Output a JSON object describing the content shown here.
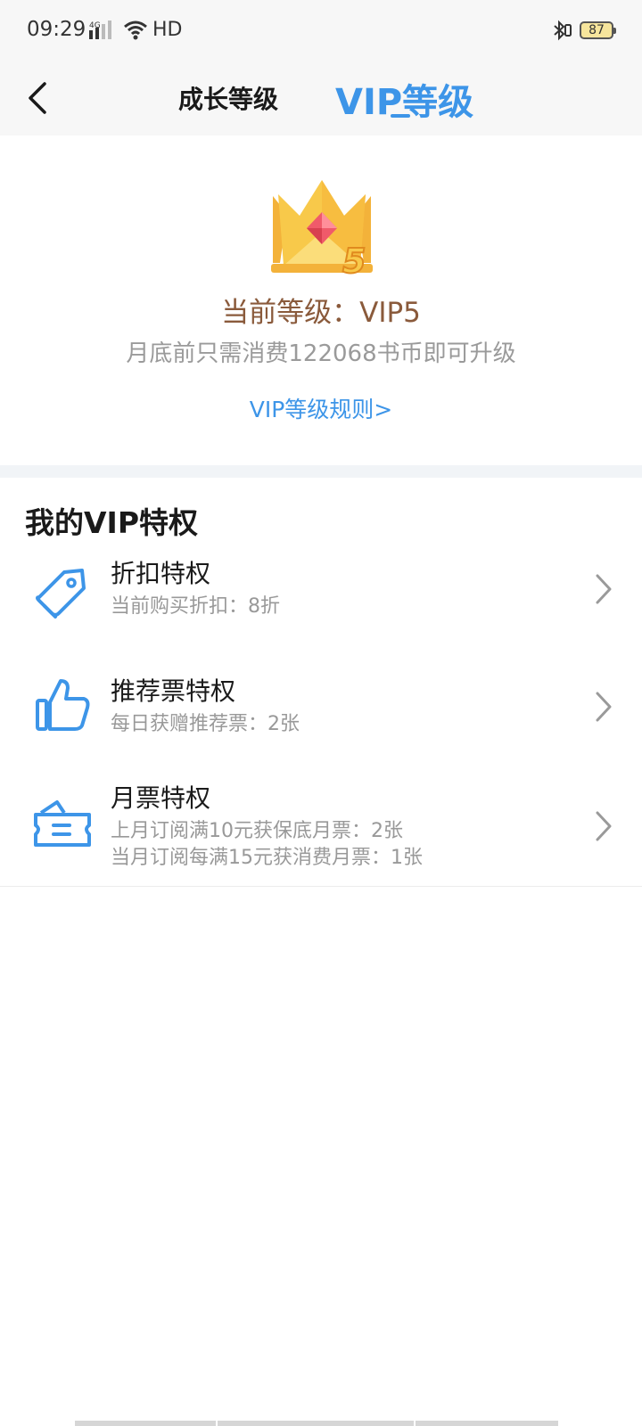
{
  "status_bar": {
    "time": "09:29",
    "network": "4G",
    "hd": "HD",
    "battery": "87"
  },
  "nav": {
    "tab_growth": "成长等级",
    "tab_vip": "VIP等级"
  },
  "hero": {
    "level_text": "当前等级：VIP5",
    "upgrade_text": "月底前只需消费122068书币即可升级",
    "rules_link": "VIP等级规则>",
    "badge_number": "5"
  },
  "privileges": {
    "title": "我的VIP特权",
    "items": [
      {
        "title": "折扣特权",
        "lines": [
          "当前购买折扣：8折"
        ],
        "icon": "tag-icon"
      },
      {
        "title": "推荐票特权",
        "lines": [
          "每日获赠推荐票：2张"
        ],
        "icon": "thumbs-up-icon"
      },
      {
        "title": "月票特权",
        "lines": [
          "上月订阅满10元获保底月票：2张",
          "当月订阅每满15元获消费月票：1张"
        ],
        "icon": "ticket-icon"
      }
    ]
  },
  "colors": {
    "accent": "#3d95e8",
    "level_text": "#8a5a3b",
    "secondary_text": "#999999",
    "crown_gold": "#f8c94a",
    "gem": "#f05a6a"
  }
}
